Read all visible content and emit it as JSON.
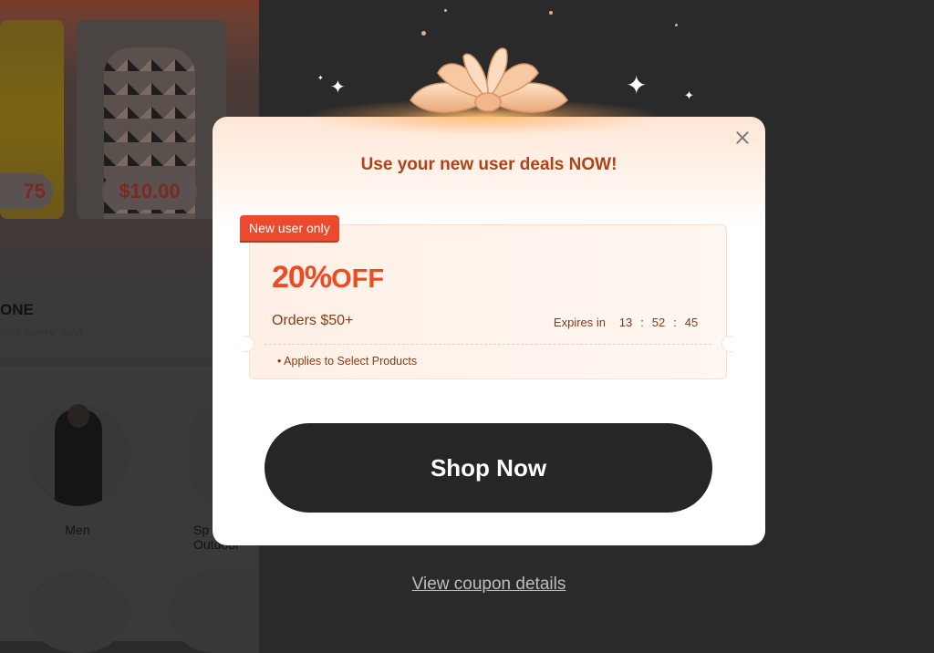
{
  "background": {
    "price_1": "75",
    "price_2": "$10.00",
    "section_heading": "ONE",
    "section_sub": "ons every day!",
    "categories": [
      {
        "label": "Men"
      },
      {
        "label": "Sports & Outdoor",
        "display": "Sp…\nOutdoor"
      }
    ]
  },
  "popup": {
    "title": "Use your new user deals NOW!",
    "tag": "New user only",
    "discount_value": "20%",
    "discount_suffix": "OFF",
    "min_order": "Orders $50+",
    "expires_label": "Expires in",
    "timer": {
      "hours": "13",
      "minutes": "52",
      "seconds": "45"
    },
    "applies": "• Applies to Select Products",
    "cta": "Shop Now",
    "close_icon": "close-icon"
  },
  "footer_link": "View coupon details",
  "colors": {
    "accent": "#ee4a24",
    "title": "#b0421a",
    "button": "#262626",
    "overlay": "#2a2a2a"
  }
}
